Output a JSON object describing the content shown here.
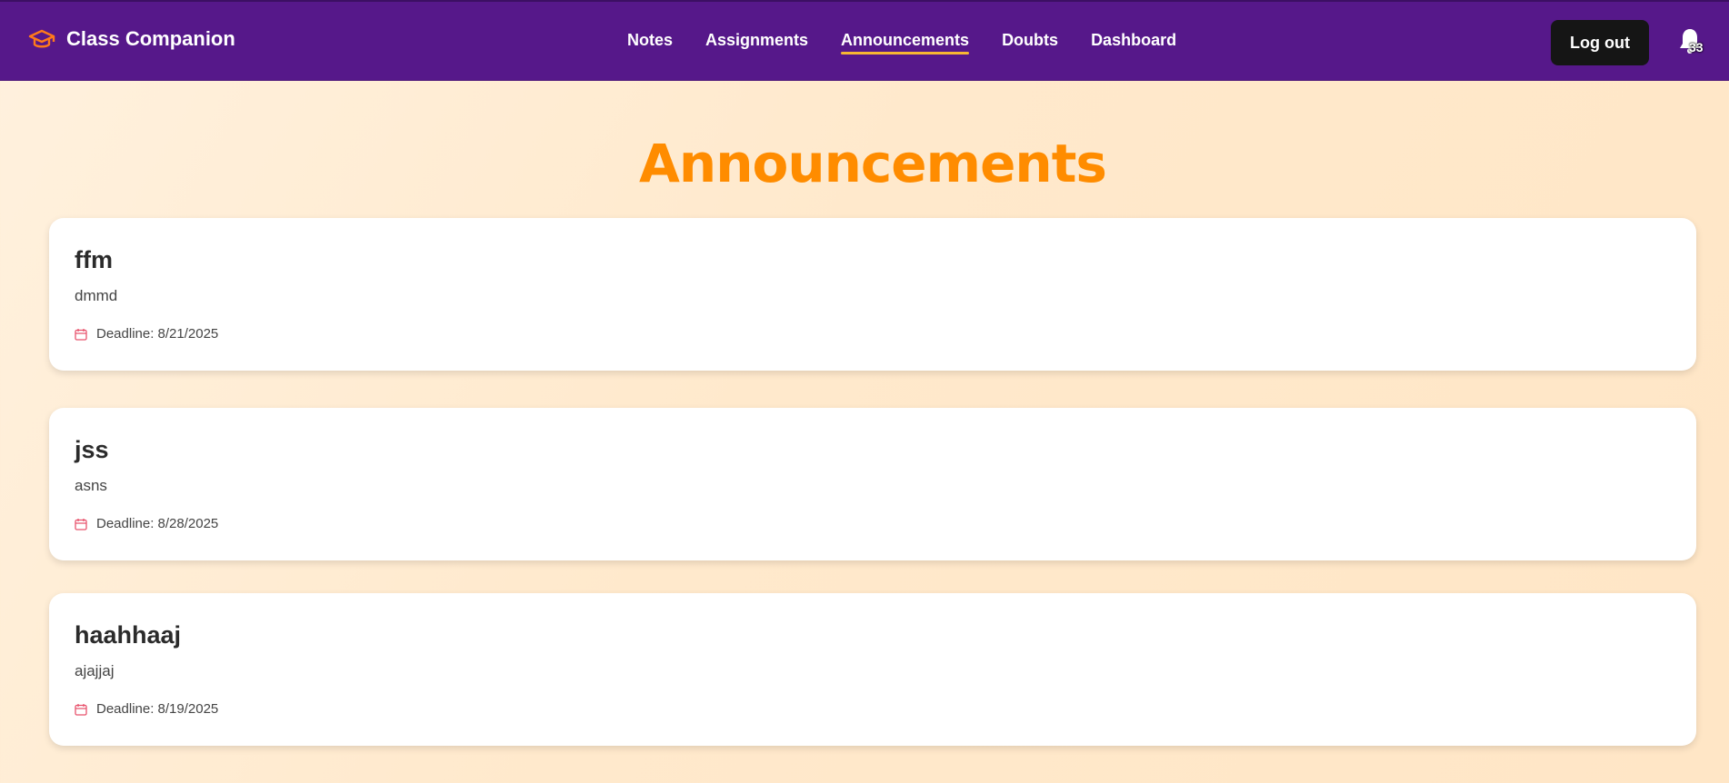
{
  "app": {
    "name": "Class Companion"
  },
  "nav": {
    "links": [
      {
        "label": "Notes"
      },
      {
        "label": "Assignments"
      },
      {
        "label": "Announcements",
        "active": true
      },
      {
        "label": "Doubts"
      },
      {
        "label": "Dashboard"
      }
    ],
    "logout_label": "Log out",
    "notification_count": "33"
  },
  "page": {
    "title": "Announcements"
  },
  "announcements": [
    {
      "title": "ffm",
      "body": "dmmd",
      "deadline": "Deadline: 8/21/2025"
    },
    {
      "title": "jss",
      "body": "asns",
      "deadline": "Deadline: 8/28/2025"
    },
    {
      "title": "haahhaaj",
      "body": "ajajjaj",
      "deadline": "Deadline: 8/19/2025"
    }
  ],
  "colors": {
    "navbar": "#56188a",
    "accent": "#ff8c00",
    "active_underline": "#f7b733",
    "calendar_icon": "#e8536d"
  },
  "icons": {
    "brand": "graduation-cap-icon",
    "notifications": "bell-icon",
    "deadline": "calendar-icon"
  }
}
